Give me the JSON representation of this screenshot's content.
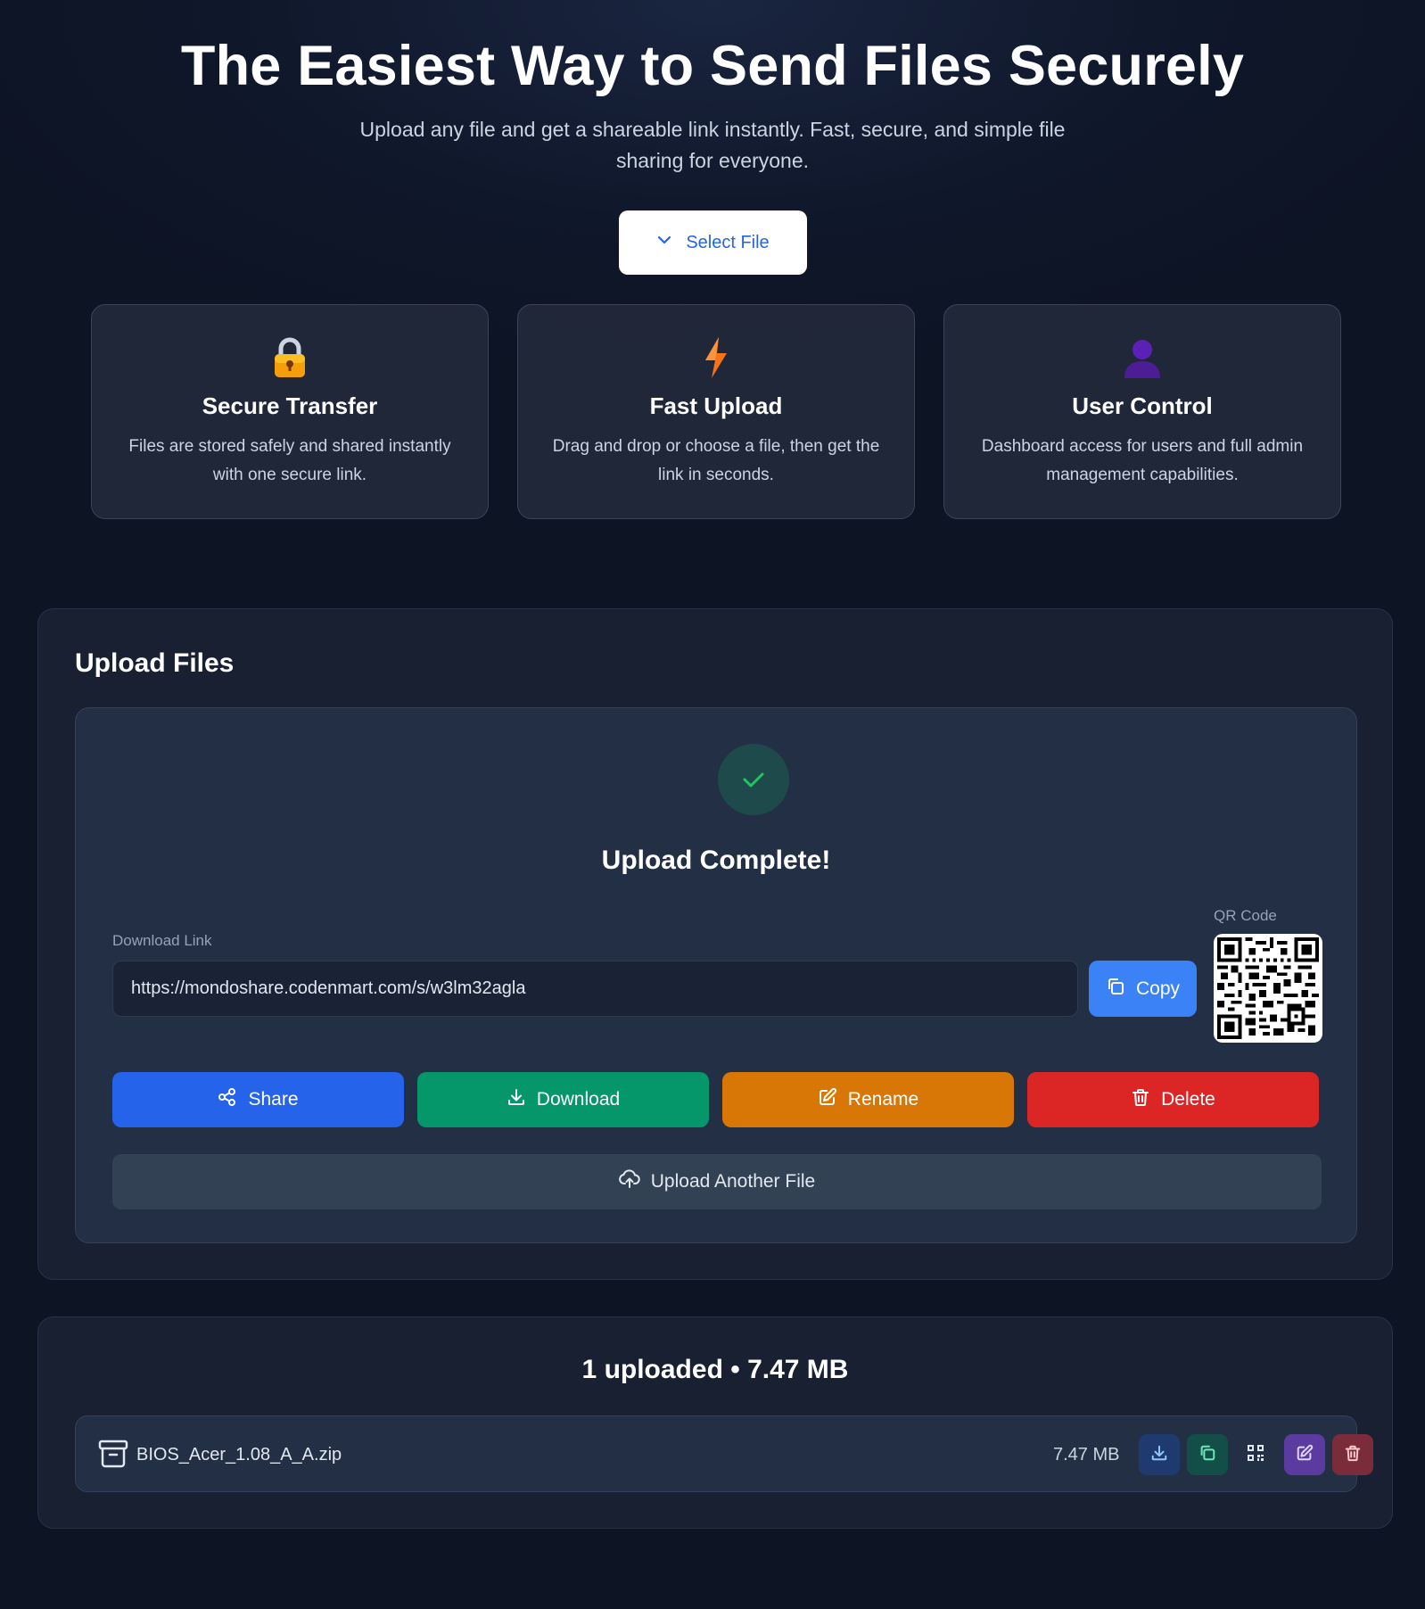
{
  "hero": {
    "title": "The Easiest Way to Send Files Securely",
    "subtitle": "Upload any file and get a shareable link instantly. Fast, secure, and simple file sharing for everyone.",
    "select_label": "Select File"
  },
  "features": [
    {
      "icon": "lock-icon",
      "title": "Secure Transfer",
      "text": "Files are stored safely and shared instantly with one secure link."
    },
    {
      "icon": "lightning-icon",
      "title": "Fast Upload",
      "text": "Drag and drop or choose a file, then get the link in seconds."
    },
    {
      "icon": "user-icon",
      "title": "User Control",
      "text": "Dashboard access for users and full admin management capabilities."
    }
  ],
  "upload": {
    "heading": "Upload Files",
    "status": "Upload Complete!",
    "link_label": "Download Link",
    "link_value": "https://mondoshare.codenmart.com/s/w3lm32agla",
    "copy_label": "Copy",
    "qr_label": "QR Code",
    "actions": {
      "share": "Share",
      "download": "Download",
      "rename": "Rename",
      "delete": "Delete"
    },
    "another_label": "Upload Another File"
  },
  "files": {
    "summary": "1 uploaded • 7.47 MB",
    "items": [
      {
        "name": "BIOS_Acer_1.08_A_A.zip",
        "size": "7.47 MB"
      }
    ]
  },
  "colors": {
    "accent": "#3b82f6",
    "share": "#2563eb",
    "download": "#059669",
    "rename": "#d97706",
    "delete": "#dc2626",
    "success": "#22c55e"
  }
}
